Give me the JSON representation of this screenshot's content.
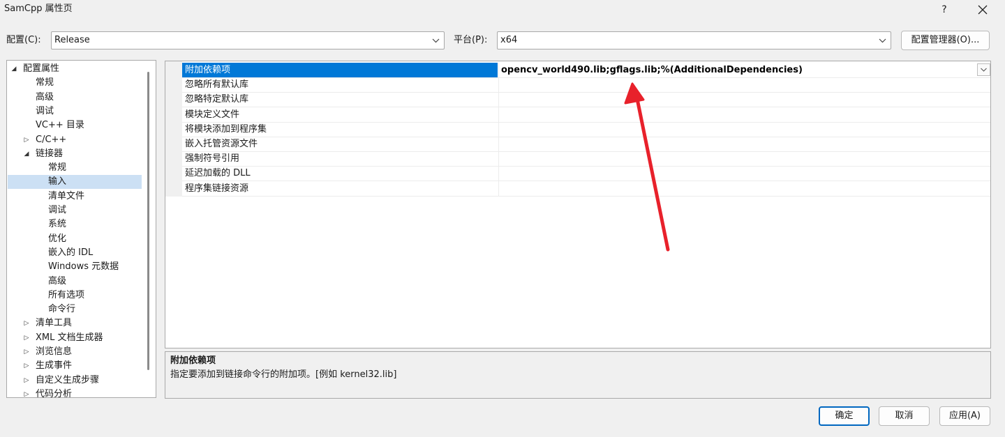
{
  "window": {
    "title": "SamCpp 属性页",
    "help": "?"
  },
  "config_row": {
    "config_label": "配置(C):",
    "config_value": "Release",
    "platform_label": "平台(P):",
    "platform_value": "x64",
    "manager_button": "配置管理器(O)..."
  },
  "tree": [
    {
      "label": "配置属性",
      "level": 0,
      "arrow": "expanded"
    },
    {
      "label": "常规",
      "level": 1,
      "arrow": "none"
    },
    {
      "label": "高级",
      "level": 1,
      "arrow": "none"
    },
    {
      "label": "调试",
      "level": 1,
      "arrow": "none"
    },
    {
      "label": "VC++ 目录",
      "level": 1,
      "arrow": "none"
    },
    {
      "label": "C/C++",
      "level": 1,
      "arrow": "collapsed"
    },
    {
      "label": "链接器",
      "level": 1,
      "arrow": "expanded"
    },
    {
      "label": "常规",
      "level": 2,
      "arrow": "none"
    },
    {
      "label": "输入",
      "level": 2,
      "arrow": "none",
      "selected": true
    },
    {
      "label": "清单文件",
      "level": 2,
      "arrow": "none"
    },
    {
      "label": "调试",
      "level": 2,
      "arrow": "none"
    },
    {
      "label": "系统",
      "level": 2,
      "arrow": "none"
    },
    {
      "label": "优化",
      "level": 2,
      "arrow": "none"
    },
    {
      "label": "嵌入的 IDL",
      "level": 2,
      "arrow": "none"
    },
    {
      "label": "Windows 元数据",
      "level": 2,
      "arrow": "none"
    },
    {
      "label": "高级",
      "level": 2,
      "arrow": "none"
    },
    {
      "label": "所有选项",
      "level": 2,
      "arrow": "none"
    },
    {
      "label": "命令行",
      "level": 2,
      "arrow": "none"
    },
    {
      "label": "清单工具",
      "level": 1,
      "arrow": "collapsed"
    },
    {
      "label": "XML 文档生成器",
      "level": 1,
      "arrow": "collapsed"
    },
    {
      "label": "浏览信息",
      "level": 1,
      "arrow": "collapsed"
    },
    {
      "label": "生成事件",
      "level": 1,
      "arrow": "collapsed"
    },
    {
      "label": "自定义生成步骤",
      "level": 1,
      "arrow": "collapsed"
    },
    {
      "label": "代码分析",
      "level": 1,
      "arrow": "collapsed"
    }
  ],
  "properties": [
    {
      "name": "附加依赖项",
      "value": "opencv_world490.lib;gflags.lib;%(AdditionalDependencies)",
      "selected": true
    },
    {
      "name": "忽略所有默认库",
      "value": ""
    },
    {
      "name": "忽略特定默认库",
      "value": ""
    },
    {
      "name": "模块定义文件",
      "value": ""
    },
    {
      "name": "将模块添加到程序集",
      "value": ""
    },
    {
      "name": "嵌入托管资源文件",
      "value": ""
    },
    {
      "name": "强制符号引用",
      "value": ""
    },
    {
      "name": "延迟加载的 DLL",
      "value": ""
    },
    {
      "name": "程序集链接资源",
      "value": ""
    }
  ],
  "description": {
    "title": "附加依赖项",
    "text": "指定要添加到链接命令行的附加项。[例如 kernel32.lib]"
  },
  "footer": {
    "ok": "确定",
    "cancel": "取消",
    "apply": "应用(A)"
  },
  "colors": {
    "selection": "#0078d7",
    "tree_selection": "#cce0f4",
    "annotation": "#e8212b"
  }
}
